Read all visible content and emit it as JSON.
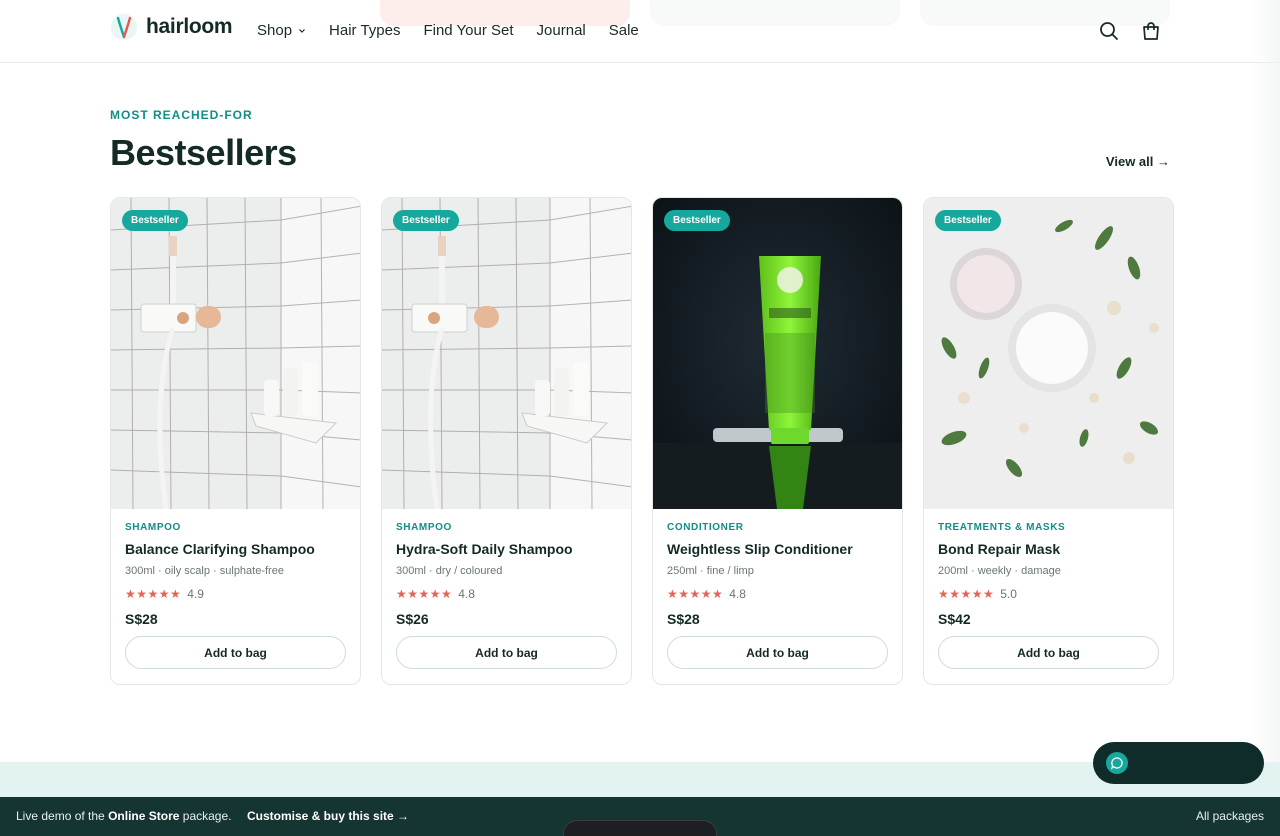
{
  "header": {
    "brand": "hairloom",
    "nav": [
      {
        "label": "Shop",
        "has_dropdown": true
      },
      {
        "label": "Hair Types"
      },
      {
        "label": "Find Your Set"
      },
      {
        "label": "Journal"
      },
      {
        "label": "Sale"
      }
    ],
    "icons": [
      "search-icon",
      "bag-icon"
    ]
  },
  "section": {
    "eyebrow": "MOST REACHED-FOR",
    "title": "Bestsellers",
    "view_all": "View all →"
  },
  "products": [
    {
      "badge": "Bestseller",
      "category": "SHAMPOO",
      "name": "Balance Clarifying Shampoo",
      "meta": "300ml · oily scalp · sulphate-free",
      "stars": "★★★★★",
      "rating": "4.9",
      "price": "S$28",
      "cta": "Add to bag"
    },
    {
      "badge": "Bestseller",
      "category": "SHAMPOO",
      "name": "Hydra-Soft Daily Shampoo",
      "meta": "300ml · dry / coloured",
      "stars": "★★★★★",
      "rating": "4.8",
      "price": "S$26",
      "cta": "Add to bag"
    },
    {
      "badge": "Bestseller",
      "category": "CONDITIONER",
      "name": "Weightless Slip Conditioner",
      "meta": "250ml · fine / limp",
      "stars": "★★★★★",
      "rating": "4.8",
      "price": "S$28",
      "cta": "Add to bag"
    },
    {
      "badge": "Bestseller",
      "category": "TREATMENTS & MASKS",
      "name": "Bond Repair Mask",
      "meta": "200ml · weekly · damage",
      "stars": "★★★★★",
      "rating": "5.0",
      "price": "S$42",
      "cta": "Add to bag"
    }
  ],
  "footer": {
    "demo_prefix": "Live demo of the",
    "demo_package": "Online Store",
    "demo_suffix": "package.",
    "customise": "Customise & buy this site →",
    "all_packages": "All packages"
  },
  "colors": {
    "accent": "#0f8f85",
    "badge": "#16a89c",
    "stars": "#e86356",
    "footer": "#143532"
  }
}
